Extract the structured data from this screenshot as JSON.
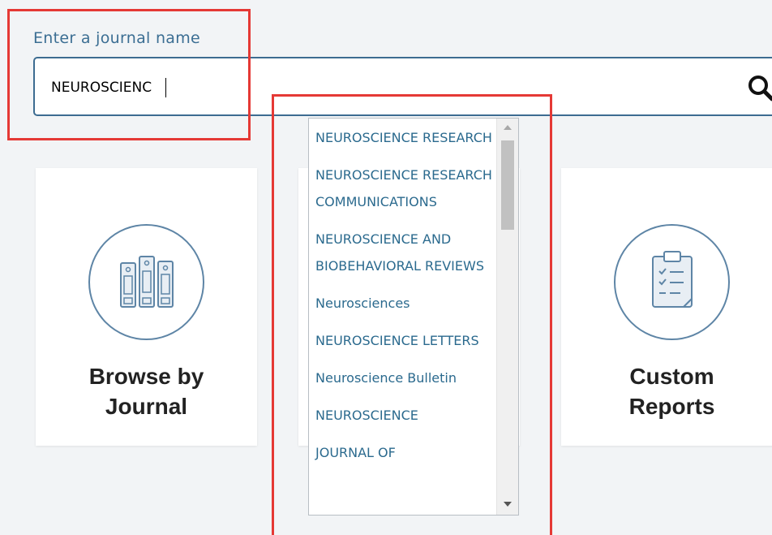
{
  "search": {
    "label": "Enter a journal name",
    "value": "NEUROSCIENC",
    "icon": "search-icon"
  },
  "cards": [
    {
      "title_line1": "Browse by",
      "title_line2": "Journal",
      "icon": "journals-binders-icon"
    },
    {
      "title_line1": "Custom",
      "title_line2": "Reports",
      "icon": "clipboard-checklist-icon"
    }
  ],
  "dropdown": {
    "items": [
      "NEUROSCIENCE RESEARCH",
      "NEUROSCIENCE RESEARCH COMMUNICATIONS",
      "NEUROSCIENCE AND BIOBEHAVIORAL REVIEWS",
      "Neurosciences",
      "NEUROSCIENCE LETTERS",
      "Neuroscience Bulletin",
      "NEUROSCIENCE",
      "JOURNAL OF"
    ]
  },
  "colors": {
    "accent": "#3d6c91",
    "link": "#2b6a8e",
    "highlight": "#e53935"
  }
}
